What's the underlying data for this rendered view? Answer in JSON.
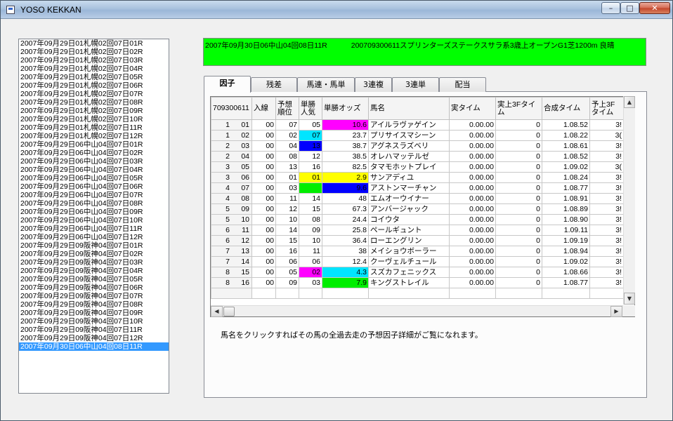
{
  "window": {
    "title": "YOSO KEKKAN",
    "min_label": "–",
    "max_label": "□",
    "close_label": "✕"
  },
  "race_list": {
    "items": [
      "2007年09月29日01札幌02回07日01R",
      "2007年09月29日01札幌02回07日02R",
      "2007年09月29日01札幌02回07日03R",
      "2007年09月29日01札幌02回07日04R",
      "2007年09月29日01札幌02回07日05R",
      "2007年09月29日01札幌02回07日06R",
      "2007年09月29日01札幌02回07日07R",
      "2007年09月29日01札幌02回07日08R",
      "2007年09月29日01札幌02回07日09R",
      "2007年09月29日01札幌02回07日10R",
      "2007年09月29日01札幌02回07日11R",
      "2007年09月29日01札幌02回07日12R",
      "2007年09月29日06中山04回07日01R",
      "2007年09月29日06中山04回07日02R",
      "2007年09月29日06中山04回07日03R",
      "2007年09月29日06中山04回07日04R",
      "2007年09月29日06中山04回07日05R",
      "2007年09月29日06中山04回07日06R",
      "2007年09月29日06中山04回07日07R",
      "2007年09月29日06中山04回07日08R",
      "2007年09月29日06中山04回07日09R",
      "2007年09月29日06中山04回07日10R",
      "2007年09月29日06中山04回07日11R",
      "2007年09月29日06中山04回07日12R",
      "2007年09月29日09阪神04回07日01R",
      "2007年09月29日09阪神04回07日02R",
      "2007年09月29日09阪神04回07日03R",
      "2007年09月29日09阪神04回07日04R",
      "2007年09月29日09阪神04回07日05R",
      "2007年09月29日09阪神04回07日06R",
      "2007年09月29日09阪神04回07日07R",
      "2007年09月29日09阪神04回07日08R",
      "2007年09月29日09阪神04回07日09R",
      "2007年09月29日09阪神04回07日10R",
      "2007年09月29日09阪神04回07日11R",
      "2007年09月29日09阪神04回07日12R",
      "2007年09月30日06中山04回08日11R"
    ],
    "selected_index": 36
  },
  "header": {
    "race": "2007年09月30日06中山04回08日11R",
    "info": "200709300611スプリンターズステークスサラ系3歳上オープンG1芝1200m 良晴"
  },
  "tabs": [
    "因子",
    "残差",
    "馬連・馬単",
    "3連複",
    "3連単",
    "配当"
  ],
  "active_tab": 0,
  "grid": {
    "columns": [
      "709300611",
      "入線",
      "予想順位",
      "単勝人気",
      "単勝オッズ",
      "馬名",
      "実タイム",
      "実上3Fタイム",
      "合成タイム",
      "予上3Fタイム"
    ],
    "rows": [
      [
        "1",
        "01",
        "00",
        "07",
        "05",
        "10.6",
        "アイルラヴァゲイン",
        "0.00.00",
        "0",
        "1.08.52",
        "3!"
      ],
      [
        "1",
        "02",
        "00",
        "02",
        "07",
        "23.7",
        "プリサイスマシーン",
        "0.00.00",
        "0",
        "1.08.22",
        "3("
      ],
      [
        "2",
        "03",
        "00",
        "04",
        "13",
        "38.7",
        "アグネスラズベリ",
        "0.00.00",
        "0",
        "1.08.61",
        "3!"
      ],
      [
        "2",
        "04",
        "00",
        "08",
        "12",
        "38.5",
        "オレハマッテルゼ",
        "0.00.00",
        "0",
        "1.08.52",
        "3!"
      ],
      [
        "3",
        "05",
        "00",
        "13",
        "16",
        "82.5",
        "タマモホットプレイ",
        "0.00.00",
        "0",
        "1.09.02",
        "3("
      ],
      [
        "3",
        "06",
        "00",
        "01",
        "01",
        "2.9",
        "サンアディユ",
        "0.00.00",
        "0",
        "1.08.24",
        "3!"
      ],
      [
        "4",
        "07",
        "00",
        "03",
        "",
        "9.6",
        "アストンマーチャン",
        "0.00.00",
        "0",
        "1.08.77",
        "3!"
      ],
      [
        "4",
        "08",
        "00",
        "11",
        "14",
        "48",
        "エムオーウイナー",
        "0.00.00",
        "0",
        "1.08.91",
        "3!"
      ],
      [
        "5",
        "09",
        "00",
        "12",
        "15",
        "67.3",
        "アンバージャック",
        "0.00.00",
        "0",
        "1.08.89",
        "3!"
      ],
      [
        "5",
        "10",
        "00",
        "10",
        "08",
        "24.4",
        "コイウタ",
        "0.00.00",
        "0",
        "1.08.90",
        "3!"
      ],
      [
        "6",
        "11",
        "00",
        "14",
        "09",
        "25.8",
        "ペールギュント",
        "0.00.00",
        "0",
        "1.09.11",
        "3!"
      ],
      [
        "6",
        "12",
        "00",
        "15",
        "10",
        "36.4",
        "ローエングリン",
        "0.00.00",
        "0",
        "1.09.19",
        "3!"
      ],
      [
        "7",
        "13",
        "00",
        "16",
        "11",
        "38",
        "メイショウボーラー",
        "0.00.00",
        "0",
        "1.08.94",
        "3!"
      ],
      [
        "7",
        "14",
        "00",
        "06",
        "06",
        "12.4",
        "クーヴェルチュール",
        "0.00.00",
        "0",
        "1.09.02",
        "3!"
      ],
      [
        "8",
        "15",
        "00",
        "05",
        "02",
        "4.3",
        "スズカフェニックス",
        "0.00.00",
        "0",
        "1.08.66",
        "3!"
      ],
      [
        "8",
        "16",
        "00",
        "09",
        "03",
        "7.9",
        "キングストレイル",
        "0.00.00",
        "0",
        "1.08.77",
        "3!"
      ]
    ],
    "highlights": [
      {
        "row": 0,
        "col": 4,
        "color": "#ff00ff"
      },
      {
        "row": 1,
        "col": 3,
        "color": "#00e5ff"
      },
      {
        "row": 2,
        "col": 3,
        "color": "#0000ff"
      },
      {
        "row": 5,
        "col": 3,
        "color": "#ffff00"
      },
      {
        "row": 5,
        "col": 4,
        "color": "#ffff00"
      },
      {
        "row": 6,
        "col": 3,
        "color": "#00ee00"
      },
      {
        "row": 6,
        "col": 4,
        "color": "#0000ff"
      },
      {
        "row": 14,
        "col": 3,
        "color": "#ff00ff"
      },
      {
        "row": 14,
        "col": 4,
        "color": "#00e5ff"
      },
      {
        "row": 15,
        "col": 4,
        "color": "#00ee00"
      }
    ]
  },
  "note": "馬名をクリックすればその馬の全過去走の予想因子詳細がご覧になれます。",
  "colors": {
    "header_bg": "#00ff00",
    "selection": "#3399ff"
  }
}
